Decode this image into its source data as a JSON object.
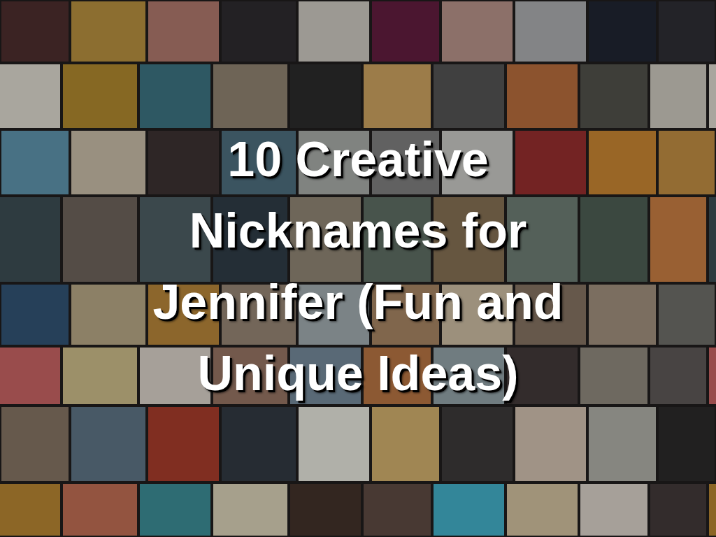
{
  "title": "10 Creative Nicknames for Jennifer (Fun and Unique Ideas)"
}
